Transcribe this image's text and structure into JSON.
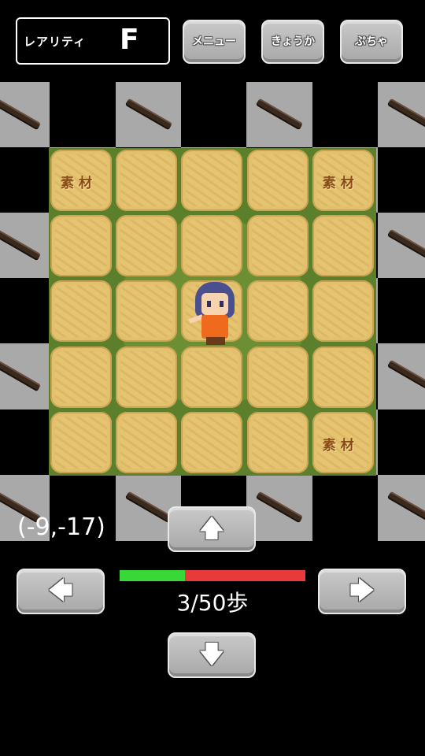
{
  "header": {
    "rarity_label": "レアリティ",
    "rarity_value": "F",
    "buttons": [
      {
        "label": "メニュー"
      },
      {
        "label": "きょうか"
      },
      {
        "label": "ぷちゃ"
      }
    ]
  },
  "field": {
    "grid_size": 5,
    "materials": [
      {
        "label": "素材",
        "row": 0,
        "col": 0
      },
      {
        "label": "素材",
        "row": 0,
        "col": 4
      },
      {
        "label": "素材",
        "row": 4,
        "col": 4
      }
    ],
    "player": {
      "row": 2,
      "col": 2
    }
  },
  "status": {
    "coordinates": "(-9,-17)",
    "steps_text": "3/50歩",
    "steps_current": 3,
    "steps_max": 50,
    "bar_used_fraction": 0.35,
    "bar_colors": {
      "remaining": "#39d839",
      "used": "#e83a3a"
    }
  },
  "controls": {
    "up": "🡅",
    "down": "🡇",
    "left": "🡄",
    "right": "🡆"
  }
}
